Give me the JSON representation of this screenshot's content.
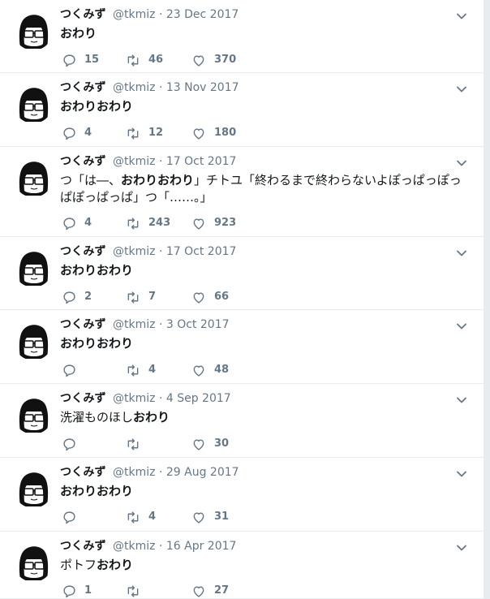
{
  "tweets": [
    {
      "name": "つくみず",
      "handle": "@tkmiz",
      "date": "23 Dec 2017",
      "text": [
        {
          "t": "おわり",
          "b": true
        }
      ],
      "replies": "15",
      "retweets": "46",
      "likes": "370"
    },
    {
      "name": "つくみず",
      "handle": "@tkmiz",
      "date": "13 Nov 2017",
      "text": [
        {
          "t": "おわりおわり",
          "b": true
        }
      ],
      "replies": "4",
      "retweets": "12",
      "likes": "180"
    },
    {
      "name": "つくみず",
      "handle": "@tkmiz",
      "date": "17 Oct 2017",
      "text": [
        {
          "t": "つ「は―、",
          "b": false
        },
        {
          "t": "おわりおわり",
          "b": true
        },
        {
          "t": "」チトユ「終わるまで終わらないよぽっぱっぽっぱぽっぱっぱ」つ「……。」",
          "b": false
        }
      ],
      "replies": "4",
      "retweets": "243",
      "likes": "923"
    },
    {
      "name": "つくみず",
      "handle": "@tkmiz",
      "date": "17 Oct 2017",
      "text": [
        {
          "t": "おわりおわり",
          "b": true
        }
      ],
      "replies": "2",
      "retweets": "7",
      "likes": "66"
    },
    {
      "name": "つくみず",
      "handle": "@tkmiz",
      "date": "3 Oct 2017",
      "text": [
        {
          "t": "おわりおわり",
          "b": true
        }
      ],
      "replies": "",
      "retweets": "4",
      "likes": "48"
    },
    {
      "name": "つくみず",
      "handle": "@tkmiz",
      "date": "4 Sep 2017",
      "text": [
        {
          "t": "洗濯ものほし",
          "b": false
        },
        {
          "t": "おわり",
          "b": true
        }
      ],
      "replies": "",
      "retweets": "",
      "likes": "30"
    },
    {
      "name": "つくみず",
      "handle": "@tkmiz",
      "date": "29 Aug 2017",
      "text": [
        {
          "t": "おわりおわり",
          "b": true
        }
      ],
      "replies": "",
      "retweets": "4",
      "likes": "31"
    },
    {
      "name": "つくみず",
      "handle": "@tkmiz",
      "date": "16 Apr 2017",
      "text": [
        {
          "t": "ポトフ",
          "b": false
        },
        {
          "t": "おわり",
          "b": true
        }
      ],
      "replies": "1",
      "retweets": "",
      "likes": "27"
    }
  ],
  "colors": {
    "text": "#14171a",
    "muted": "#657786",
    "divider": "#e6ecf0",
    "icon": "#657786"
  },
  "icons": {
    "reply": "reply-icon",
    "retweet": "retweet-icon",
    "like": "heart-icon",
    "caret": "chevron-down-icon",
    "avatar": "avatar"
  }
}
